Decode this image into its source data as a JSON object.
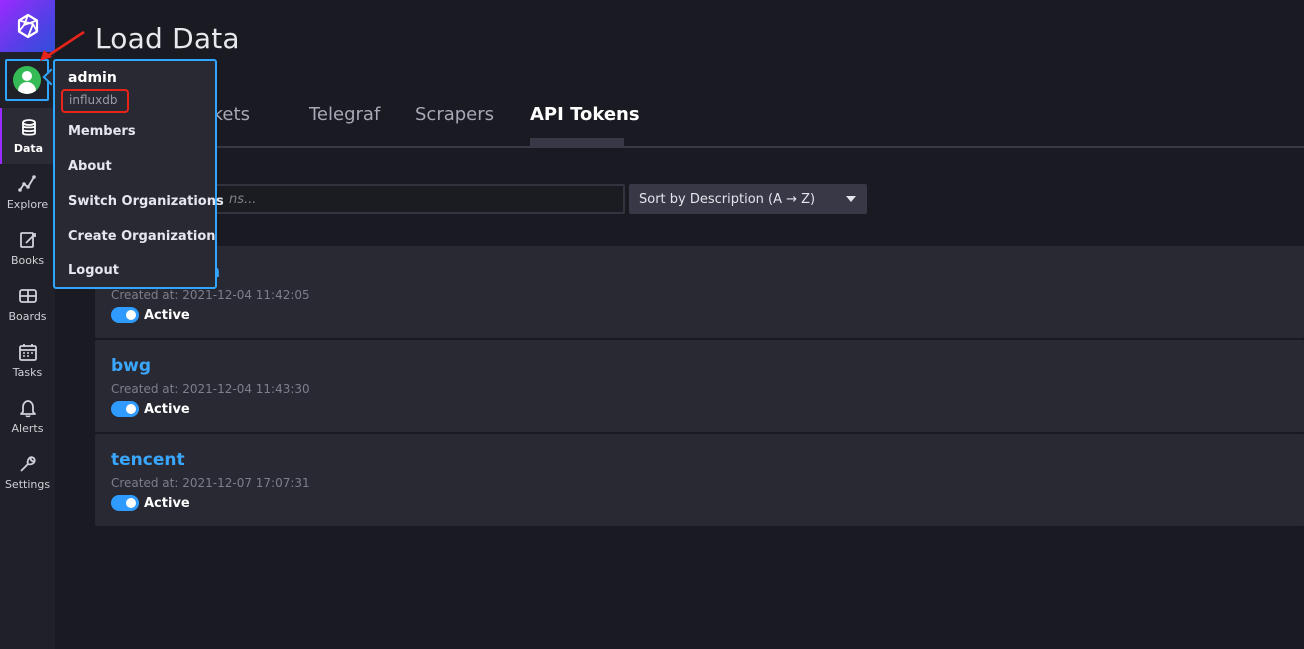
{
  "sidebar": {
    "items": [
      {
        "label": "Data",
        "icon": "database-icon"
      },
      {
        "label": "Explore",
        "icon": "graph-icon"
      },
      {
        "label": "Books",
        "icon": "notebook-icon"
      },
      {
        "label": "Boards",
        "icon": "dashboard-icon"
      },
      {
        "label": "Tasks",
        "icon": "calendar-icon"
      },
      {
        "label": "Alerts",
        "icon": "bell-icon"
      },
      {
        "label": "Settings",
        "icon": "wrench-icon"
      }
    ]
  },
  "header": {
    "title": "Load Data"
  },
  "tabs": [
    {
      "label": "Buckets"
    },
    {
      "label": "Telegraf"
    },
    {
      "label": "Scrapers"
    },
    {
      "label": "API Tokens"
    }
  ],
  "search": {
    "placeholder": "ns..."
  },
  "sort": {
    "label": "Sort by Description (A → Z)"
  },
  "tokens": [
    {
      "name": "n",
      "created": "Created at: 2021-12-04 11:42:05",
      "status": "Active"
    },
    {
      "name": "bwg",
      "created": "Created at: 2021-12-04 11:43:30",
      "status": "Active"
    },
    {
      "name": "tencent",
      "created": "Created at: 2021-12-07 17:07:31",
      "status": "Active"
    }
  ],
  "user_menu": {
    "username": "admin",
    "org": "influxdb",
    "items": [
      "Members",
      "About",
      "Switch Organizations",
      "Create Organization",
      "Logout"
    ]
  },
  "colors": {
    "accent": "#2fa6ff",
    "brand": "#9b2aff",
    "highlight": "#e8241a"
  }
}
